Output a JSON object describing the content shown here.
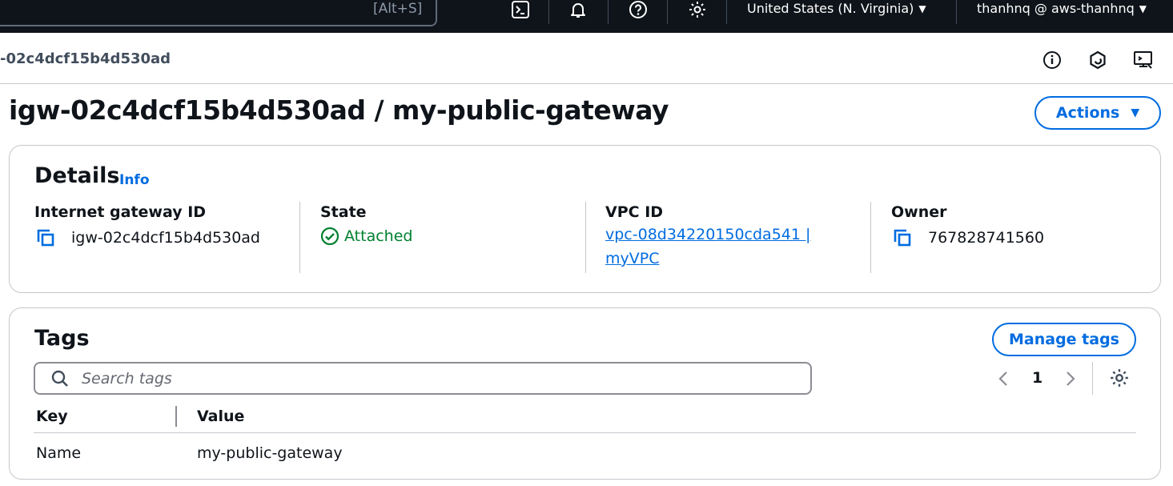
{
  "topnav": {
    "search_shortcut": "[Alt+S]",
    "region": "United States (N. Virginia)",
    "account": "thanhnq @ aws-thanhnq"
  },
  "breadcrumb": {
    "current": "-02c4dcf15b4d530ad"
  },
  "page": {
    "title": "igw-02c4dcf15b4d530ad / my-public-gateway",
    "actions_label": "Actions"
  },
  "details": {
    "heading": "Details",
    "info_label": "Info",
    "gateway_id_label": "Internet gateway ID",
    "gateway_id": "igw-02c4dcf15b4d530ad",
    "state_label": "State",
    "state": "Attached",
    "vpc_id_label": "VPC ID",
    "vpc_id_line1": "vpc-08d34220150cda541 |",
    "vpc_id_line2": "myVPC",
    "owner_label": "Owner",
    "owner": "767828741560"
  },
  "tags": {
    "heading": "Tags",
    "manage_label": "Manage tags",
    "search_placeholder": "Search tags",
    "page": "1",
    "columns": [
      "Key",
      "Value"
    ],
    "rows": [
      {
        "key": "Name",
        "value": "my-public-gateway"
      }
    ]
  },
  "colors": {
    "accent": "#006ce0",
    "success": "#00802f",
    "nav_bg": "#0f141a"
  }
}
